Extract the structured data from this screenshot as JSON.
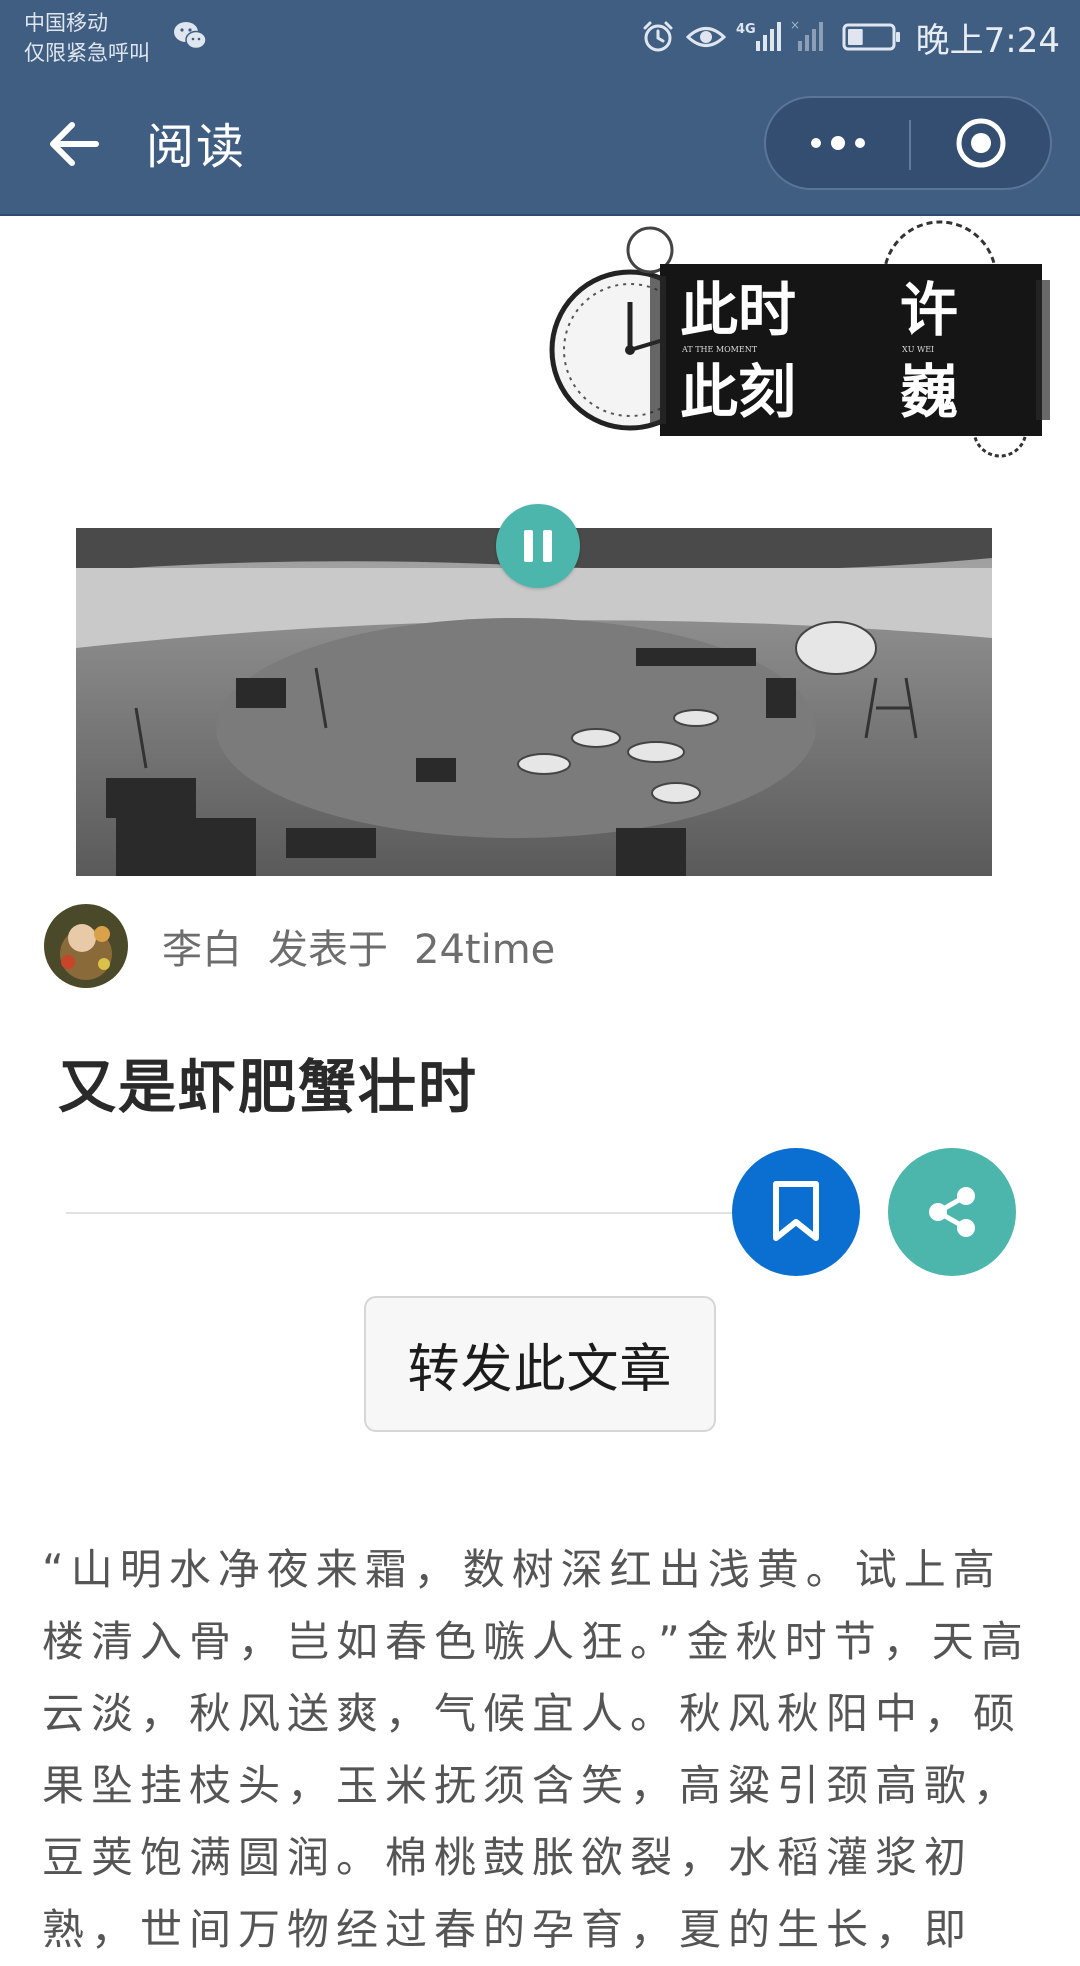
{
  "status_bar": {
    "carrier_line1": "中国移动",
    "carrier_line2": "仅限紧急呼叫",
    "network_label": "4G",
    "time": "晚上7:24",
    "battery_level": 0.35,
    "icons": [
      "wechat-icon",
      "alarm-icon",
      "eye-icon",
      "signal-icon",
      "battery-icon"
    ],
    "background": "#3f5e82"
  },
  "nav": {
    "back_icon": "arrow-left-icon",
    "title": "阅读",
    "more_icon": "more-dots-icon",
    "close_icon": "target-circle-icon"
  },
  "header_image": {
    "stamp_lines": [
      "此时",
      "此刻",
      "许",
      "巍"
    ],
    "stamp_subtitles": [
      "AT THE MOMENT",
      "XU WEI"
    ]
  },
  "player": {
    "state": "playing",
    "button_icon": "pause-icon",
    "accent": "#4db6ac"
  },
  "author": {
    "name": "李白",
    "posted_label": "发表于",
    "source": "24time"
  },
  "article": {
    "title": "又是虾肥蟹壮时",
    "forward_label": "转发此文章",
    "bookmark_icon": "bookmark-icon",
    "share_icon": "share-icon",
    "bookmark_color": "#0a6fd0",
    "share_color": "#4db6ac",
    "body": "“山明水净夜来霜，数树深红出浅黄。试上高楼清入骨，岂如春色嗾人狂。”金秋时节，天高云淡，秋风送爽，气候宜人。秋风秋阳中，硕果坠挂枝头，玉米抚须含笑，高粱引颈高歌，豆荚饱满圆润。棉桃鼓胀欲裂，水稻灌浆初熟，世间万物经过春的孕育，夏的生长，即"
  }
}
